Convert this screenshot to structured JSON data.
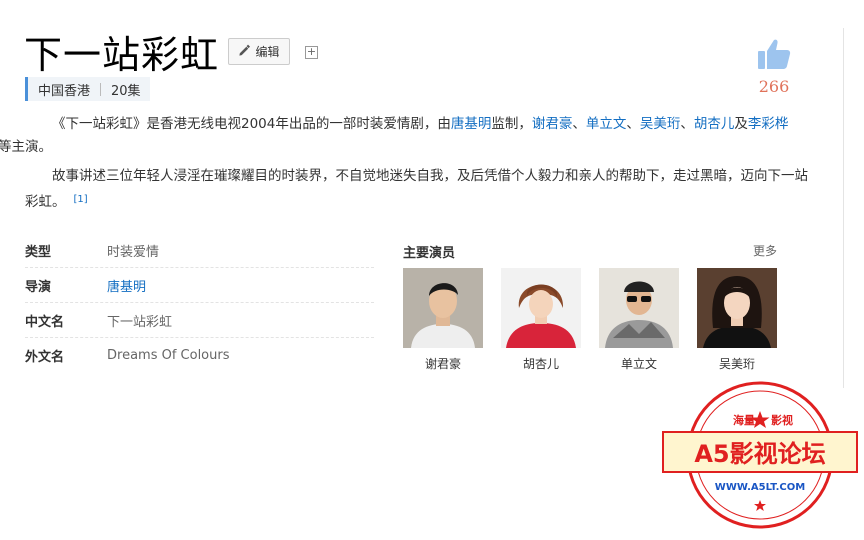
{
  "page": {
    "title": "下一站彩虹",
    "edit_label": "编辑",
    "add_symbol": "+"
  },
  "tags": [
    "中国香港",
    "20集"
  ],
  "like": {
    "count": "266"
  },
  "summary": {
    "p1": {
      "pre": "《下一站彩虹》是香港无线电视2004年出品的一部时装爱情剧，由",
      "director": "唐基明",
      "mid": "监制，",
      "cast": [
        "谢君豪",
        "单立文",
        "吴美珩",
        "胡杏儿",
        "李彩桦"
      ],
      "sep": "、",
      "and": "及",
      "post": "等主演。"
    },
    "p2": {
      "text": "故事讲述三位年轻人浸淫在璀璨耀目的时装界，不自觉地迷失自我，及后凭借个人毅力和亲人的帮助下，走过黑暗，迈向下一站彩虹。",
      "ref": "[1]"
    }
  },
  "info": [
    {
      "label": "类型",
      "value": "时装爱情"
    },
    {
      "label": "导演",
      "value": "唐基明"
    },
    {
      "label": "中文名",
      "value": "下一站彩虹"
    },
    {
      "label": "外文名",
      "value": "Dreams Of Colours"
    }
  ],
  "actors": {
    "title": "主要演员",
    "more": "更多",
    "list": [
      {
        "name": "谢君豪"
      },
      {
        "name": "胡杏儿"
      },
      {
        "name": "单立文"
      },
      {
        "name": "吴美珩"
      }
    ]
  },
  "watermark": {
    "top_left": "海量",
    "top_right": "影视",
    "main": "A5影视论坛",
    "url": "WWW.A5LT.COM",
    "color": "#e02020"
  }
}
